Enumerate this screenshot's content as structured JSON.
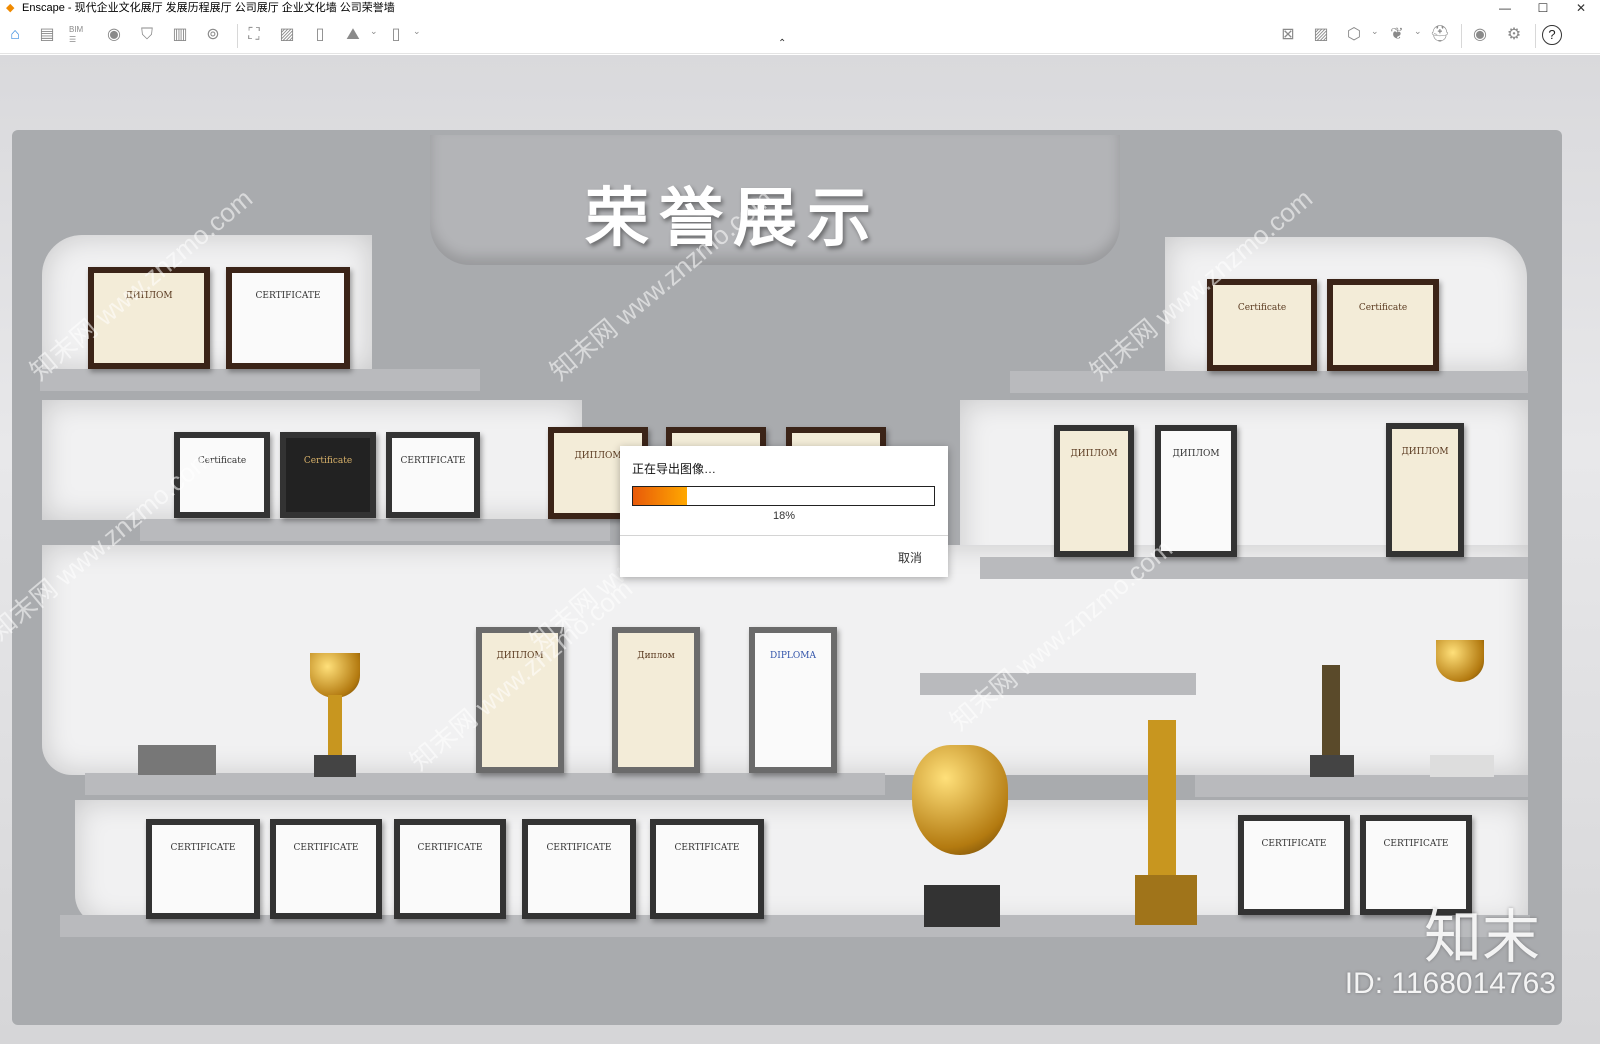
{
  "window": {
    "title": "Enscape - 现代企业文化展厅 发展历程展厅 公司展厅 企业文化墙 公司荣誉墙",
    "controls": {
      "minimize": "—",
      "maximize": "☐",
      "close": "✕"
    }
  },
  "toolbar": {
    "left_icons": [
      "home-icon",
      "notes-icon",
      "bim-icon",
      "views-icon",
      "assets-icon",
      "building-icon",
      "video-icon",
      "screenshot-icon",
      "batch-render-icon",
      "panorama-upload-icon",
      "panorama-360-icon",
      "exe-export-icon"
    ],
    "right_icons": [
      "map-icon",
      "gallery-icon",
      "cube-icon",
      "wings-icon",
      "vr-headset-icon",
      "visual-settings-icon",
      "settings-icon",
      "help-icon"
    ],
    "bim_label": "BIM",
    "help_label": "?"
  },
  "scene": {
    "heading": "荣誉展示",
    "frames": [
      "ДИПЛОМ",
      "CERTIFICATE",
      "Certificate",
      "Certificate",
      "Certificate",
      "Certificate",
      "CERTIFICATE",
      "ДИПЛОМ",
      "ДИПЛОМ",
      "ДИПЛОМ",
      "ДИПЛОМ",
      "ДИПЛОМ",
      "Диплом",
      "DIPLOMA",
      "CERTIFICATE",
      "CERTIFICATE",
      "CERTIFICATE",
      "CERTIFICATE",
      "CERTIFICATE",
      "CERTIFICATE",
      "CERTIFICATE"
    ],
    "watermark": "知末网 www.znzmo.com",
    "brand": "知末",
    "id_text": "ID: 1168014763"
  },
  "dialog": {
    "title": "正在导出图像…",
    "progress_percent": 18,
    "progress_label": "18%",
    "cancel_label": "取消",
    "accent_colors": [
      "#e85a0a",
      "#ffa800"
    ]
  }
}
